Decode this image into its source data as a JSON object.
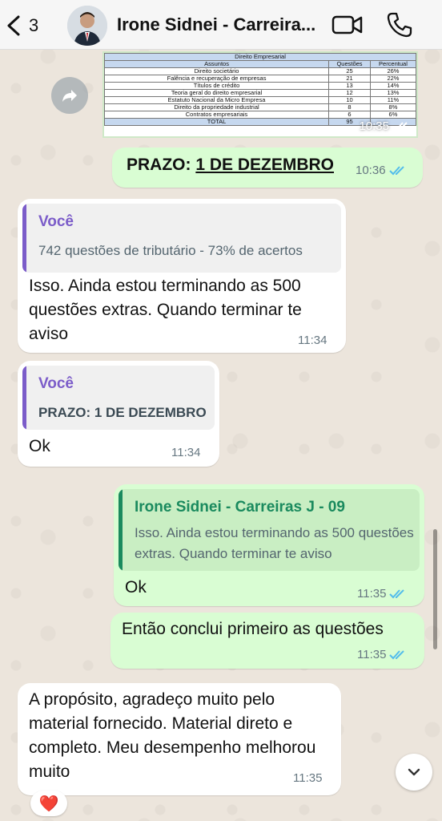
{
  "header": {
    "back_count": "3",
    "title": "Irone Sidnei - Carreira..."
  },
  "image_table": {
    "caption": "Direito Empresarial",
    "columns": [
      "Assuntos",
      "Questões",
      "Percentual"
    ],
    "rows": [
      [
        "Direito societário",
        "25",
        "26%"
      ],
      [
        "Falência e recuperação de empresas",
        "21",
        "22%"
      ],
      [
        "Títulos de crédito",
        "13",
        "14%"
      ],
      [
        "Teoria geral do direito empresarial",
        "12",
        "13%"
      ],
      [
        "Estatuto Nacional da Micro Empresa",
        "10",
        "11%"
      ],
      [
        "Direito da propriedade industrial",
        "8",
        "8%"
      ],
      [
        "Contratos empresariais",
        "6",
        "6%"
      ]
    ],
    "total_label": "TOTAL",
    "total_value": "95",
    "total_pct": "",
    "time": "10:35"
  },
  "messages": {
    "prazo": {
      "prefix": "PRAZO: ",
      "highlight": "1 DE DEZEMBRO",
      "time": "10:36"
    },
    "reply1": {
      "quote_name": "Você",
      "quote_text": "742 questões de tributário - 73% de acertos",
      "text": "Isso. Ainda estou terminando as 500 questões extras. Quando terminar te aviso",
      "time": "11:34"
    },
    "reply2": {
      "quote_name": "Você",
      "quote_text": "PRAZO: 1 DE DEZEMBRO",
      "text": "Ok",
      "time": "11:34"
    },
    "out_ok": {
      "quote_name": "Irone Sidnei - Carreiras J - 09",
      "quote_text": "Isso. Ainda estou terminando as 500 questões extras. Quando terminar te aviso",
      "text": "Ok",
      "time": "11:35"
    },
    "out_conclui": {
      "text": "Então conclui primeiro as questões",
      "time": "11:35"
    },
    "in_last": {
      "text": "A propósito, agradeço muito pelo material fornecido. Material direto e completo. Meu desempenho melhorou muito",
      "time": "11:35"
    },
    "reaction": "❤️"
  },
  "colors": {
    "quote_you": "#7b5cc9",
    "quote_contact": "#1a8a5e",
    "ticks": "#53bdeb",
    "outgoing": "#d9fdd3"
  }
}
